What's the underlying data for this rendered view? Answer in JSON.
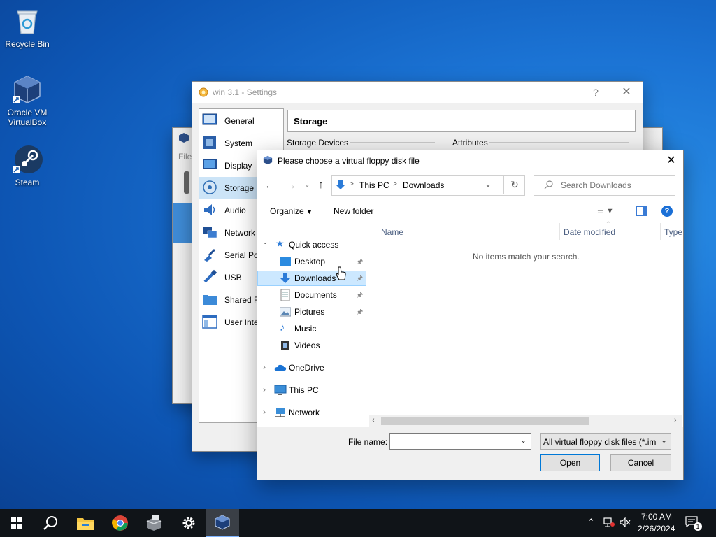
{
  "desktop": {
    "icons": [
      {
        "label": "Recycle Bin"
      },
      {
        "label": "Oracle VM VirtualBox"
      },
      {
        "label": "Steam"
      }
    ]
  },
  "settings_window": {
    "title": "win 3.1 - Settings",
    "help": "?",
    "close": "✕",
    "section_title": "Storage",
    "storage_devices_label": "Storage Devices",
    "attributes_label": "Attributes",
    "sidebar": [
      {
        "label": "General",
        "icon": "general-icon"
      },
      {
        "label": "System",
        "icon": "system-icon"
      },
      {
        "label": "Display",
        "icon": "display-icon"
      },
      {
        "label": "Storage",
        "icon": "storage-icon",
        "selected": true
      },
      {
        "label": "Audio",
        "icon": "audio-icon"
      },
      {
        "label": "Network",
        "icon": "network-icon"
      },
      {
        "label": "Serial Por",
        "icon": "serial-port-icon"
      },
      {
        "label": "USB",
        "icon": "usb-icon"
      },
      {
        "label": "Shared Fo",
        "icon": "shared-folders-icon"
      },
      {
        "label": "User Inte",
        "icon": "user-interface-icon"
      }
    ]
  },
  "back_window": {
    "menu_file": "File"
  },
  "file_dialog": {
    "title": "Please choose a virtual floppy disk file",
    "close": "✕",
    "breadcrumb": [
      "This PC",
      "Downloads"
    ],
    "breadcrumb_sep": ">",
    "search_placeholder": "Search Downloads",
    "organize_label": "Organize",
    "new_folder_label": "New folder",
    "columns": [
      "Name",
      "Date modified",
      "Type"
    ],
    "empty_message": "No items match your search.",
    "nav": {
      "quick_access": "Quick access",
      "items": [
        {
          "label": "Desktop",
          "pinned": true
        },
        {
          "label": "Downloads",
          "pinned": true,
          "selected": true
        },
        {
          "label": "Documents",
          "pinned": true
        },
        {
          "label": "Pictures",
          "pinned": true
        },
        {
          "label": "Music"
        },
        {
          "label": "Videos"
        }
      ],
      "onedrive": "OneDrive",
      "this_pc": "This PC",
      "network": "Network"
    },
    "file_name_label": "File name:",
    "file_name_value": "",
    "file_type_value": "All virtual floppy disk files (*.im",
    "open_label": "Open",
    "cancel_label": "Cancel"
  },
  "taskbar": {
    "time": "7:00 AM",
    "date": "2/26/2024",
    "notification_count": "1"
  }
}
